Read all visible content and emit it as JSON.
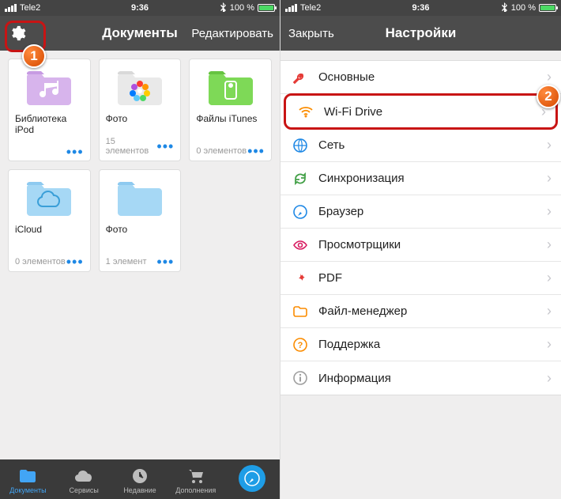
{
  "status": {
    "carrier": "Tele2",
    "time": "9:36",
    "battery": "100 %"
  },
  "left": {
    "title": "Документы",
    "edit": "Редактировать",
    "folders": [
      {
        "name": "Библиотека iPod",
        "sub": ""
      },
      {
        "name": "Фото",
        "sub": "15 элементов"
      },
      {
        "name": "Файлы iTunes",
        "sub": "0 элементов"
      },
      {
        "name": "iCloud",
        "sub": "0 элементов"
      },
      {
        "name": "Фото",
        "sub": "1 элемент"
      }
    ],
    "tabs": {
      "documents": "Документы",
      "services": "Сервисы",
      "recent": "Недавние",
      "addons": "Дополнения"
    },
    "callout": "1"
  },
  "right": {
    "close": "Закрыть",
    "title": "Настройки",
    "rows": {
      "general": "Основные",
      "wifi": "Wi-Fi Drive",
      "network": "Сеть",
      "sync": "Синхронизация",
      "browser": "Браузер",
      "viewers": "Просмотрщики",
      "pdf": "PDF",
      "files": "Файл-менеджер",
      "support": "Поддержка",
      "info": "Информация"
    },
    "callout": "2"
  }
}
